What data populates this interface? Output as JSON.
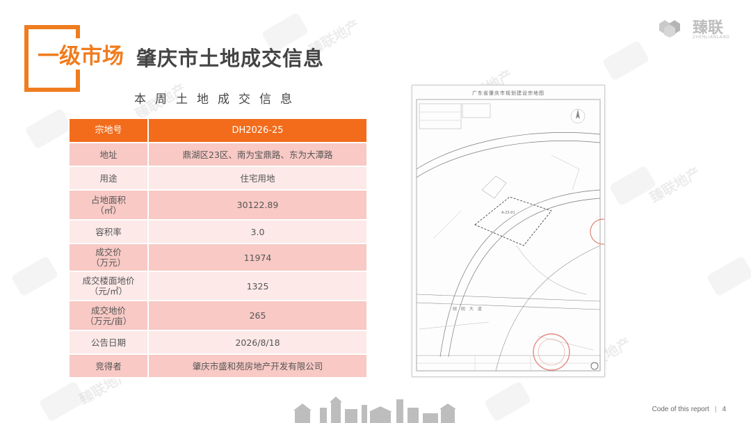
{
  "header": {
    "section_tag": "一级市场",
    "title": "肇庆市土地成交信息"
  },
  "logo": {
    "name": "臻联",
    "subtitle": "ZHENLIANLAND"
  },
  "watermark": {
    "text": "臻联地产"
  },
  "table": {
    "caption": "本周土地成交信息",
    "header": {
      "label": "宗地号",
      "value": "DH2026-25"
    },
    "rows": [
      {
        "label": "地址",
        "value": "鼎湖区23区、南为宝鼎路、东为大潭路"
      },
      {
        "label": "用途",
        "value": "住宅用地"
      },
      {
        "label": "占地面积",
        "label_unit": "（㎡）",
        "value": "30122.89"
      },
      {
        "label": "容积率",
        "value": "3.0"
      },
      {
        "label": "成交价",
        "label_unit": "（万元）",
        "value": "11974"
      },
      {
        "label": "成交楼面地价",
        "label_unit": "（元/㎡）",
        "value": "1325"
      },
      {
        "label": "成交地价",
        "label_unit": "（万元/亩）",
        "value": "265"
      },
      {
        "label": "公告日期",
        "value": "2026/8/18"
      },
      {
        "label": "竞得者",
        "value": "肇庆市盛和苑房地产开发有限公司"
      }
    ]
  },
  "map": {
    "title": "广东省肇庆市规划建设宗地图",
    "parcel_label": "A-23-01",
    "road_label": "砚 砚 大 道"
  },
  "footer": {
    "report_text": "Code of this report",
    "separator": "|",
    "page_number": "4"
  },
  "colors": {
    "accent": "#f07c1e",
    "header_row": "#f26c1c",
    "row_dark": "#f8c9c5",
    "row_light": "#fce9e8"
  }
}
